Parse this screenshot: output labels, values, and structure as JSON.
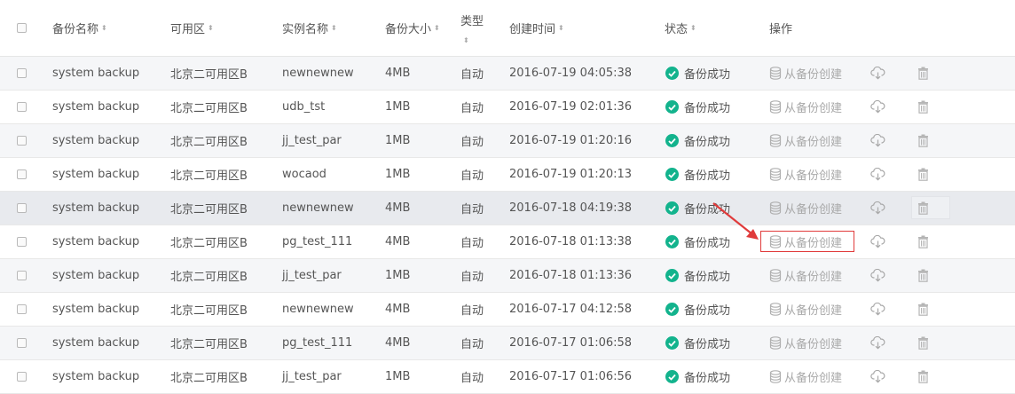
{
  "headers": {
    "name": "备份名称",
    "zone": "可用区",
    "instance": "实例名称",
    "size": "备份大小",
    "type": "类型",
    "created": "创建时间",
    "status": "状态",
    "ops": "操作"
  },
  "sort_glyph": "⬍",
  "create_label": "从备份创建",
  "colors": {
    "success": "#13b38d",
    "highlight": "#e03b3b",
    "muted": "#a9a9a9"
  },
  "icons": {
    "status": "check-circle-icon",
    "create": "database-icon",
    "download": "cloud-download-icon",
    "delete": "trash-icon"
  },
  "rows": [
    {
      "name": "system backup",
      "zone": "北京二可用区B",
      "instance": "newnewnew",
      "size": "4MB",
      "type": "自动",
      "created": "2016-07-19 04:05:38",
      "status": "备份成功"
    },
    {
      "name": "system backup",
      "zone": "北京二可用区B",
      "instance": "udb_tst",
      "size": "1MB",
      "type": "自动",
      "created": "2016-07-19 02:01:36",
      "status": "备份成功"
    },
    {
      "name": "system backup",
      "zone": "北京二可用区B",
      "instance": "jj_test_par",
      "size": "1MB",
      "type": "自动",
      "created": "2016-07-19 01:20:16",
      "status": "备份成功"
    },
    {
      "name": "system backup",
      "zone": "北京二可用区B",
      "instance": "wocaod",
      "size": "1MB",
      "type": "自动",
      "created": "2016-07-19 01:20:13",
      "status": "备份成功"
    },
    {
      "name": "system backup",
      "zone": "北京二可用区B",
      "instance": "newnewnew",
      "size": "4MB",
      "type": "自动",
      "created": "2016-07-18 04:19:38",
      "status": "备份成功"
    },
    {
      "name": "system backup",
      "zone": "北京二可用区B",
      "instance": "pg_test_111",
      "size": "4MB",
      "type": "自动",
      "created": "2016-07-18 01:13:38",
      "status": "备份成功"
    },
    {
      "name": "system backup",
      "zone": "北京二可用区B",
      "instance": "jj_test_par",
      "size": "1MB",
      "type": "自动",
      "created": "2016-07-18 01:13:36",
      "status": "备份成功"
    },
    {
      "name": "system backup",
      "zone": "北京二可用区B",
      "instance": "newnewnew",
      "size": "4MB",
      "type": "自动",
      "created": "2016-07-17 04:12:58",
      "status": "备份成功"
    },
    {
      "name": "system backup",
      "zone": "北京二可用区B",
      "instance": "pg_test_111",
      "size": "4MB",
      "type": "自动",
      "created": "2016-07-17 01:06:58",
      "status": "备份成功"
    },
    {
      "name": "system backup",
      "zone": "北京二可用区B",
      "instance": "jj_test_par",
      "size": "1MB",
      "type": "自动",
      "created": "2016-07-17 01:06:56",
      "status": "备份成功"
    }
  ]
}
